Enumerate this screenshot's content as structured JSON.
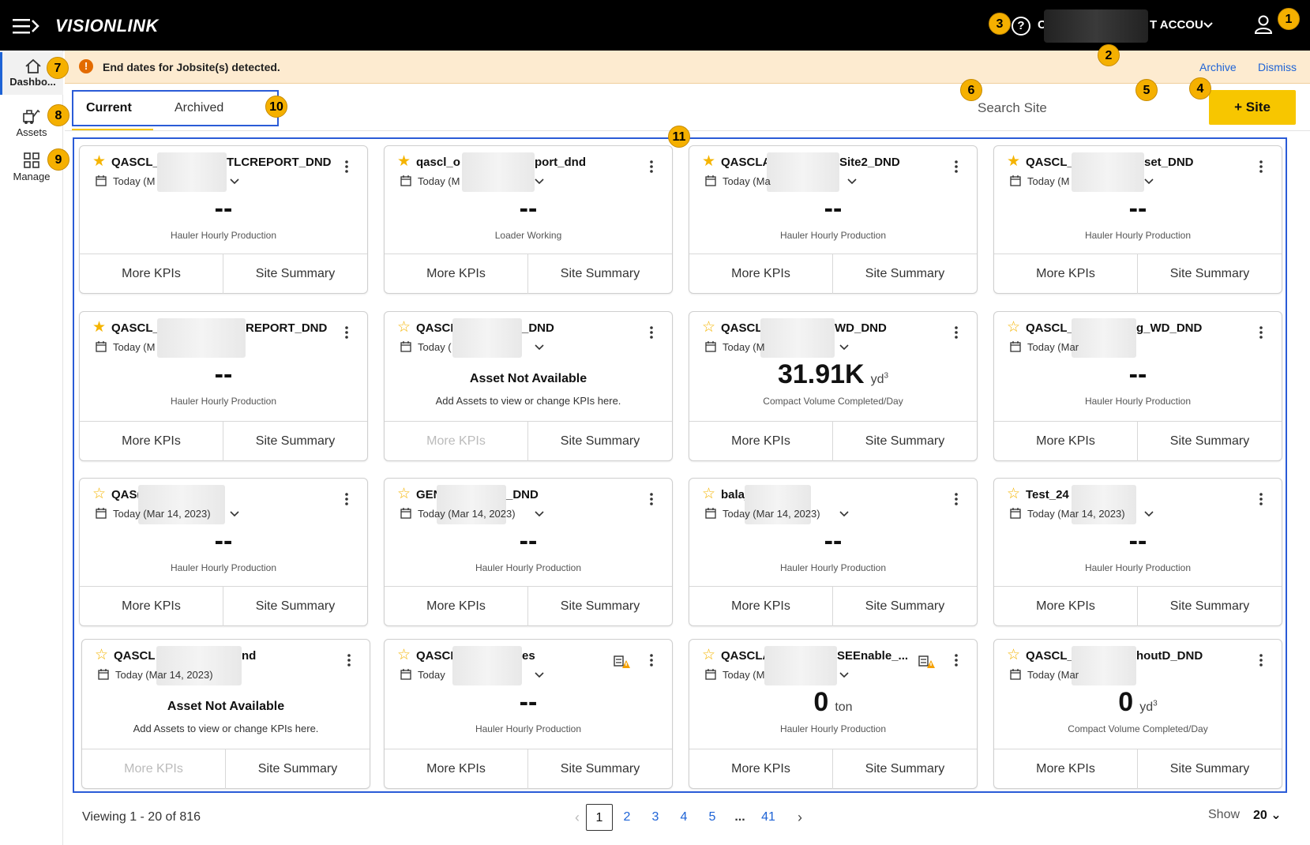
{
  "header": {
    "logo": "VISIONLINK",
    "help_glyph": "?",
    "account_prefix": "C",
    "account_suffix": "T ACCOU",
    "icons": [
      "hamburger-icon",
      "help-icon",
      "chevron-down-icon",
      "user-icon"
    ]
  },
  "badges": [
    "1",
    "2",
    "3",
    "4",
    "5",
    "6",
    "7",
    "8",
    "9",
    "10",
    "11"
  ],
  "sidenav": [
    {
      "label": "Dashbo...",
      "icon": "home-icon"
    },
    {
      "label": "Assets",
      "icon": "assets-icon"
    },
    {
      "label": "Manage",
      "icon": "manage-icon"
    }
  ],
  "banner": {
    "warn_glyph": "!",
    "message": "End dates for Jobsite(s) detected.",
    "archive": "Archive",
    "dismiss": "Dismiss"
  },
  "tabs": {
    "current": "Current",
    "archived": "Archived"
  },
  "search": {
    "placeholder": "Search Site"
  },
  "add_button": "+ Site",
  "cards": [
    {
      "fav": true,
      "name": "QASCL_",
      "name_tail": "TLCREPORT_DND",
      "date": "Today (M",
      "value": "--",
      "unit": "",
      "kpi": "Hauler Hourly Production"
    },
    {
      "fav": true,
      "name": "qascl_o",
      "name_tail": "port_dnd",
      "date": "Today (M",
      "value": "--",
      "unit": "",
      "kpi": "Loader Working"
    },
    {
      "fav": true,
      "name": "QASCLAI",
      "name_tail": "Site2_DND",
      "date": "Today (Ma",
      "value": "--",
      "unit": "",
      "kpi": "Hauler Hourly Production"
    },
    {
      "fav": true,
      "name": "QASCL_",
      "name_tail": "set_DND",
      "date": "Today (M",
      "value": "--",
      "unit": "",
      "kpi": "Hauler Hourly Production"
    },
    {
      "fav": true,
      "name": "QASCL_",
      "name_tail": "REPORT_DND",
      "date": "Today (M",
      "value": "--",
      "unit": "",
      "kpi": "Hauler Hourly Production"
    },
    {
      "fav": false,
      "name": "QASCI",
      "name_tail": "_DND",
      "date": "Today (",
      "not_available": true,
      "na_title": "Asset Not Available",
      "na_sub": "Add Assets to view or change KPIs here."
    },
    {
      "fav": false,
      "name": "QASCL_",
      "name_tail": "WD_DND",
      "date": "Today (M",
      "value": "31.91K",
      "unit": "yd",
      "unit_sup": "3",
      "kpi": "Compact Volume Completed/Day"
    },
    {
      "fav": false,
      "name": "QASCL_Cc",
      "name_tail": "g_WD_DND",
      "date": "Today (Mar",
      "value": "--",
      "unit": "",
      "kpi": "Hauler Hourly Production"
    },
    {
      "fav": false,
      "name": "QAS(",
      "name_tail": "",
      "date": "Today (Mar 14, 2023)",
      "value": "--",
      "unit": "",
      "kpi": "Hauler Hourly Production"
    },
    {
      "fav": false,
      "name": "GEN",
      "name_tail": "_DND",
      "date": "Today (Mar 14, 2023)",
      "value": "--",
      "unit": "",
      "kpi": "Hauler Hourly Production"
    },
    {
      "fav": false,
      "name": "balaj",
      "name_tail": "",
      "date": "Today (Mar 14, 2023)",
      "value": "--",
      "unit": "",
      "kpi": "Hauler Hourly Production"
    },
    {
      "fav": false,
      "name": "Test_24",
      "name_tail": "",
      "date": "Today (Mar 14, 2023)",
      "value": "--",
      "unit": "",
      "kpi": "Hauler Hourly Production"
    },
    {
      "fav": false,
      "name": "QASCL",
      "name_tail": "nd",
      "date": "Today (Mar 14, 2023)",
      "not_available": true,
      "na_title": "Asset Not Available",
      "na_sub": "Add Assets to view or change KPIs here."
    },
    {
      "fav": false,
      "name": "QASCI",
      "name_tail": "es",
      "date": "Today",
      "warn_icon": true,
      "value": "--",
      "unit": "",
      "kpi": "Hauler Hourly Production"
    },
    {
      "fav": false,
      "name": "QASCLA",
      "name_tail": "SEEnable_...",
      "date": "Today (M",
      "warn_icon": true,
      "value": "0",
      "unit": "ton",
      "kpi": "Hauler Hourly Production"
    },
    {
      "fav": false,
      "name": "QASCL_co",
      "name_tail": "houtD_DND",
      "date": "Today (Mar",
      "value": "0",
      "unit": "yd",
      "unit_sup": "3",
      "kpi": "Compact Volume Completed/Day"
    }
  ],
  "card_buttons": {
    "more": "More KPIs",
    "summary": "Site Summary"
  },
  "footer": {
    "viewing": "Viewing 1 - 20 of 816",
    "pages": [
      "1",
      "2",
      "3",
      "4",
      "5",
      "...",
      "41"
    ],
    "current_page": "1",
    "prev": "‹",
    "next": "›",
    "show_label": "Show",
    "show_value": "20 ⌄"
  },
  "colors": {
    "accent": "#f7c600",
    "link": "#1e63d6",
    "highlight": "#2a5bd7",
    "banner": "#fdebd0",
    "badge": "#f5b000"
  }
}
